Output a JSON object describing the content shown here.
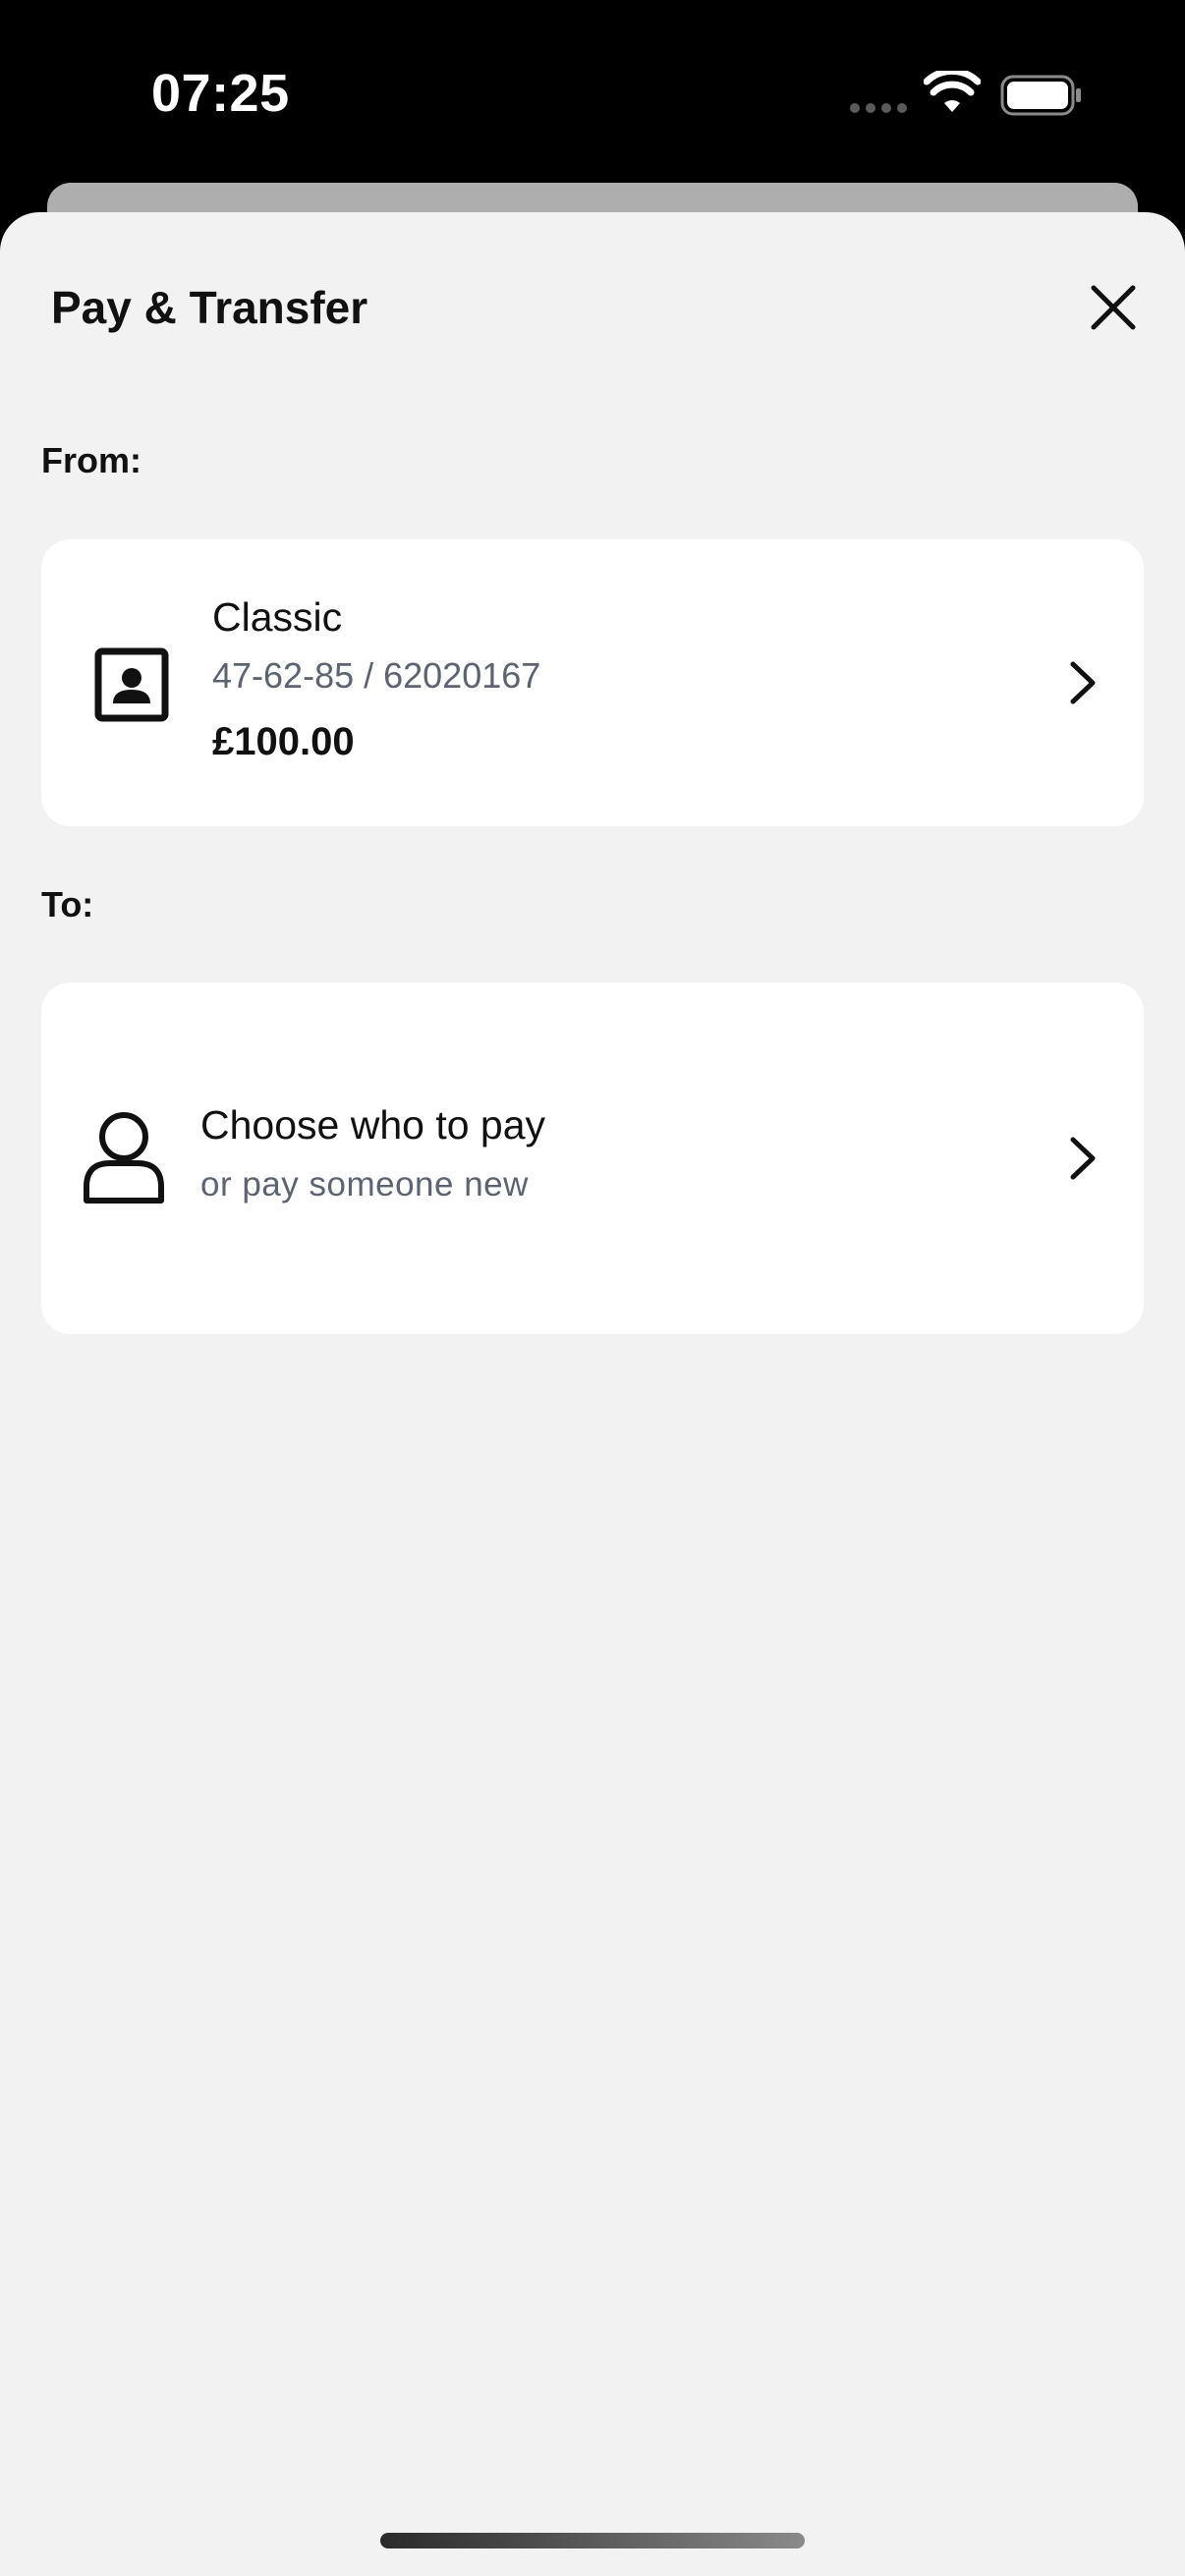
{
  "status_bar": {
    "time": "07:25"
  },
  "sheet": {
    "title": "Pay & Transfer",
    "close_icon": "close-icon"
  },
  "from": {
    "label": "From:",
    "account": {
      "name": "Classic",
      "number": "47-62-85 / 62020167",
      "balance": "£100.00",
      "icon": "account-icon"
    }
  },
  "to": {
    "label": "To:",
    "payee": {
      "title": "Choose who to pay",
      "subtitle": "or pay someone new",
      "icon": "person-icon"
    }
  },
  "colors": {
    "sheet_background": "#f2f2f2",
    "card_background": "#ffffff",
    "text_primary": "#111111",
    "text_secondary": "#5d6470"
  }
}
